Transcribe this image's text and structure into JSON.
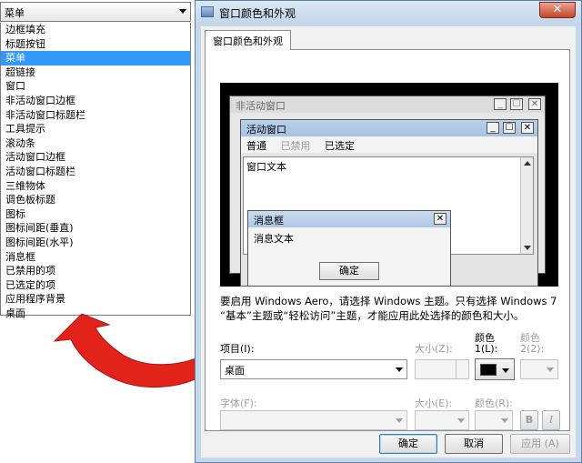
{
  "dropdown": {
    "selected": "菜单",
    "items": [
      "边框填充",
      "标题按钮",
      "菜单",
      "超链接",
      "窗口",
      "非活动窗口边框",
      "非活动窗口标题栏",
      "工具提示",
      "滚动条",
      "活动窗口边框",
      "活动窗口标题栏",
      "三维物体",
      "调色板标题",
      "图标",
      "图标间距(垂直)",
      "图标间距(水平)",
      "消息框",
      "已禁用的项",
      "已选定的项",
      "应用程序背景",
      "桌面"
    ],
    "highlighted_index": 2
  },
  "dialog": {
    "title": "窗口颜色和外观",
    "close_glyph": "✕",
    "tab": "窗口颜色和外观",
    "preview": {
      "inactive_title": "非活动窗口",
      "active_title": "活动窗口",
      "menu_normal": "普通",
      "menu_disabled": "已禁用",
      "menu_selected": "已选定",
      "window_text": "窗口文本",
      "msgbox_title": "消息框",
      "msgbox_text": "消息文本",
      "msgbox_ok": "确定",
      "btn_min": "_",
      "btn_max": "☐",
      "btn_close": "✕"
    },
    "note": "要启用 Windows Aero，请选择 Windows 主题。只有选择 Windows 7 “基本”主题或“轻松访问”主题，才能应用此处选择的颜色和大小。",
    "item_label": "项目(I):",
    "item_value": "桌面",
    "size_label": "大小(Z):",
    "color1_label_a": "颜色",
    "color1_label_b": "1(L):",
    "color2_label_a": "颜色",
    "color2_label_b": "2(2):",
    "font_label": "字体(F):",
    "font_size_label": "大小(E):",
    "font_color_label": "颜色(R):",
    "bold": "B",
    "italic": "I",
    "ok": "确定",
    "cancel": "取消",
    "apply": "应用 (A)",
    "color1_value": "#000000"
  }
}
